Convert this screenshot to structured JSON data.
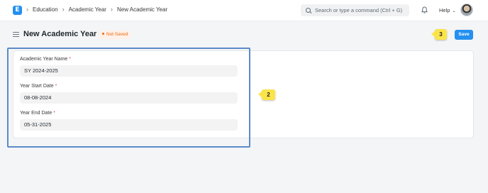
{
  "nav": {
    "logo": "E",
    "breadcrumbs": [
      "Education",
      "Academic Year",
      "New Academic Year"
    ],
    "search_placeholder": "Search or type a command (Ctrl + G)",
    "help_label": "Help"
  },
  "page": {
    "title": "New Academic Year",
    "status": "Not Saved",
    "save_label": "Save"
  },
  "form": {
    "fields": [
      {
        "label": "Academic Year Name",
        "required": "*",
        "value": "SY 2024-2025"
      },
      {
        "label": "Year Start Date",
        "required": "*",
        "value": "08-08-2024"
      },
      {
        "label": "Year End Date",
        "required": "*",
        "value": "05-31-2025"
      }
    ]
  },
  "callouts": {
    "form": "2",
    "save": "3"
  },
  "colors": {
    "accent": "#2490ef",
    "status": "#e86c13",
    "callout": "#fbe44a",
    "highlight": "#5b8bc9"
  },
  "icons": {
    "search": "search-icon",
    "bell": "bell-icon",
    "menu": "hamburger-icon",
    "help_caret": "chevron-down-icon"
  }
}
